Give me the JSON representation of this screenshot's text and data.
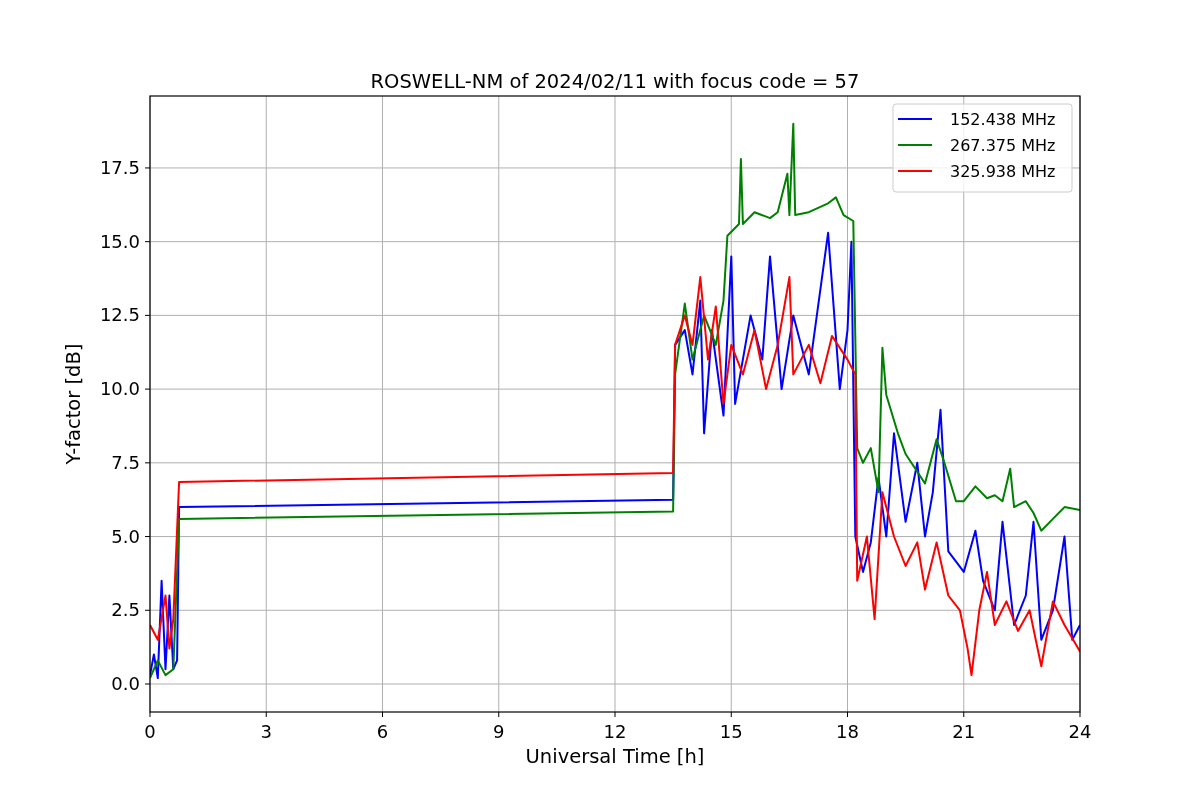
{
  "chart": {
    "chart_data": {
      "type": "line",
      "title": "ROSWELL-NM of 2024/02/11 with focus code = 57",
      "xlabel": "Universal Time [h]",
      "ylabel": "Y-factor [dB]",
      "grid": true,
      "legend": true,
      "xlim": [
        0,
        24
      ],
      "ylim": [
        -0.95,
        19.94
      ],
      "xticks": [
        0,
        3,
        6,
        9,
        12,
        15,
        18,
        21,
        24
      ],
      "yticks": [
        {
          "value": 0,
          "label": "0.0"
        },
        {
          "value": 2.5,
          "label": "2.5"
        },
        {
          "value": 5,
          "label": "5.0"
        },
        {
          "value": 7.5,
          "label": "7.5"
        },
        {
          "value": 10,
          "label": "10.0"
        },
        {
          "value": 12.5,
          "label": "12.5"
        },
        {
          "value": 15,
          "label": "15.0"
        },
        {
          "value": 17.5,
          "label": "17.5"
        }
      ],
      "series": [
        {
          "name": "152.438 MHz",
          "color": "#0000ff",
          "x": [
            0,
            0.1,
            0.2,
            0.3,
            0.4,
            0.5,
            0.6,
            0.7,
            0.75,
            13.5,
            13.55,
            13.8,
            14.0,
            14.2,
            14.3,
            14.5,
            14.8,
            15.0,
            15.1,
            15.5,
            15.8,
            16.0,
            16.3,
            16.6,
            17.0,
            17.5,
            17.8,
            18.0,
            18.1,
            18.2,
            18.4,
            18.6,
            18.8,
            19.0,
            19.2,
            19.5,
            19.8,
            20.0,
            20.2,
            20.4,
            20.6,
            21.0,
            21.3,
            21.5,
            21.8,
            22.0,
            22.3,
            22.6,
            22.8,
            23.0,
            23.3,
            23.6,
            23.8,
            24
          ],
          "values": [
            0.3,
            1.0,
            0.2,
            3.5,
            0.5,
            3.0,
            0.5,
            0.8,
            6.0,
            6.25,
            11.5,
            12.0,
            10.5,
            13.0,
            8.5,
            12.0,
            9.1,
            14.5,
            9.5,
            12.5,
            11.0,
            14.5,
            10.0,
            12.5,
            10.5,
            15.3,
            10.0,
            12.0,
            15.0,
            5.0,
            3.8,
            4.8,
            7.0,
            5.0,
            8.5,
            5.5,
            7.5,
            5.0,
            6.5,
            9.3,
            4.5,
            3.8,
            5.2,
            3.5,
            2.5,
            5.5,
            2.0,
            3.0,
            5.5,
            1.5,
            2.5,
            5.0,
            1.5,
            2.0
          ]
        },
        {
          "name": "267.375 MHz",
          "color": "#008000",
          "x": [
            0,
            0.2,
            0.4,
            0.6,
            0.75,
            13.5,
            13.55,
            13.8,
            14.0,
            14.3,
            14.6,
            14.8,
            14.9,
            15.2,
            15.25,
            15.3,
            15.6,
            16.0,
            16.2,
            16.45,
            16.5,
            16.6,
            16.65,
            17.0,
            17.5,
            17.7,
            17.9,
            18.15,
            18.25,
            18.4,
            18.6,
            18.8,
            18.9,
            19.0,
            19.3,
            19.5,
            19.8,
            20.0,
            20.3,
            20.5,
            20.8,
            21.0,
            21.3,
            21.6,
            21.8,
            22.0,
            22.2,
            22.3,
            22.6,
            22.8,
            23.0,
            23.3,
            23.6,
            24
          ],
          "values": [
            0.2,
            0.8,
            0.3,
            0.5,
            5.6,
            5.85,
            10.5,
            12.9,
            11.0,
            12.5,
            11.5,
            13.0,
            15.2,
            15.6,
            17.8,
            15.6,
            16.0,
            15.8,
            16.0,
            17.3,
            15.9,
            19.0,
            15.9,
            16.0,
            16.3,
            16.5,
            15.9,
            15.7,
            8.0,
            7.5,
            8.0,
            6.5,
            11.4,
            9.8,
            8.5,
            7.8,
            7.2,
            6.8,
            8.3,
            7.5,
            6.2,
            6.2,
            6.7,
            6.3,
            6.4,
            6.2,
            7.3,
            6.0,
            6.2,
            5.8,
            5.2,
            5.6,
            6.0,
            5.9
          ]
        },
        {
          "name": "325.938 MHz",
          "color": "#ff0000",
          "x": [
            0,
            0.2,
            0.4,
            0.5,
            0.6,
            0.65,
            0.75,
            13.5,
            13.55,
            13.8,
            14.0,
            14.2,
            14.4,
            14.6,
            14.8,
            15.0,
            15.3,
            15.6,
            15.9,
            16.2,
            16.5,
            16.6,
            17.0,
            17.3,
            17.6,
            18.0,
            18.2,
            18.25,
            18.5,
            18.7,
            18.9,
            19.2,
            19.5,
            19.8,
            20.0,
            20.3,
            20.6,
            20.9,
            21.1,
            21.2,
            21.4,
            21.6,
            21.8,
            22.1,
            22.4,
            22.7,
            23.0,
            23.3,
            23.6,
            24
          ],
          "values": [
            2.0,
            1.5,
            3.0,
            1.2,
            2.2,
            3.7,
            6.85,
            7.15,
            11.5,
            12.5,
            11.5,
            13.8,
            11.0,
            12.8,
            9.5,
            11.5,
            10.5,
            12.0,
            10.0,
            11.5,
            13.8,
            10.5,
            11.5,
            10.2,
            11.8,
            11.0,
            10.5,
            3.5,
            5.0,
            2.2,
            6.5,
            5.0,
            4.0,
            4.8,
            3.2,
            4.8,
            3.0,
            2.5,
            1.2,
            0.3,
            2.5,
            3.8,
            2.0,
            2.8,
            1.8,
            2.5,
            0.6,
            2.8,
            2.0,
            1.1
          ]
        }
      ]
    }
  }
}
